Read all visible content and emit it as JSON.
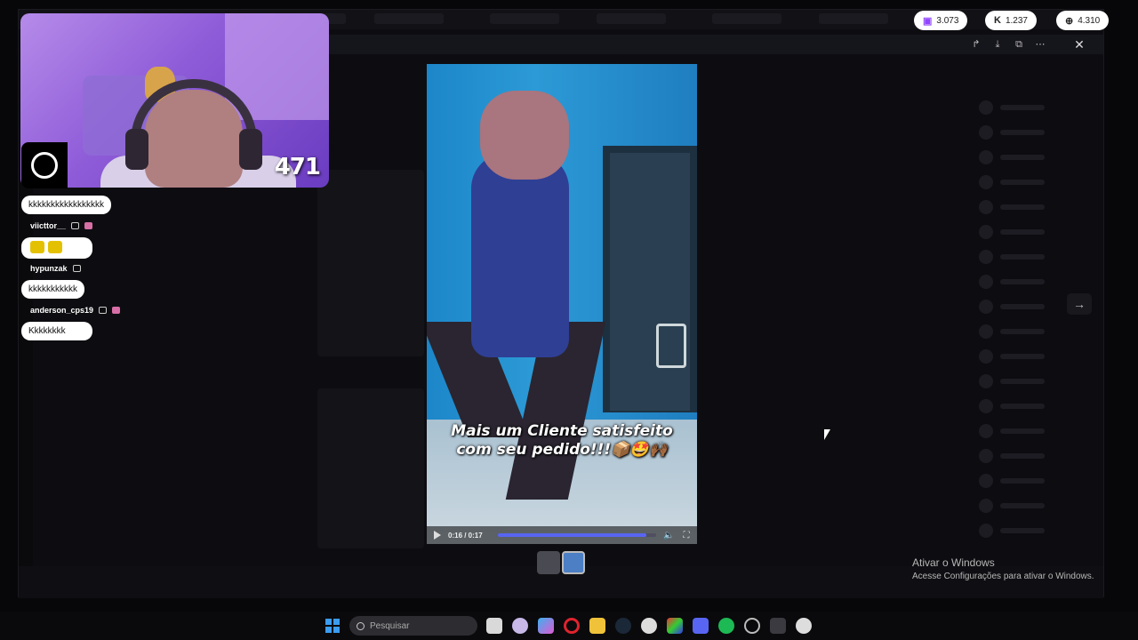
{
  "stats": {
    "twitch_count": "3.073",
    "kick_count": "1.237",
    "total_count": "4.310",
    "twitch_icon": "twitch-icon",
    "kick_icon": "kick-icon",
    "globe_icon": "globe-icon"
  },
  "webcam": {
    "counter": "471"
  },
  "chat": {
    "messages": [
      {
        "user": "",
        "text": "kkkkkkkkkkkkkkkkk"
      },
      {
        "user": "viicttor__",
        "text": ""
      },
      {
        "user": "hypunzak",
        "text": "kkkkkkkkkkk"
      },
      {
        "user": "anderson_cps19",
        "text": "Kkkkkkkk"
      }
    ]
  },
  "video": {
    "caption_line1": "Mais um Cliente satisfeito",
    "caption_line2": "com seu pedido!!!📦🤩🙌🏾",
    "time": "0:16 / 0:17",
    "progress": 0.94
  },
  "windows": {
    "activate_title": "Ativar o Windows",
    "activate_sub": "Acesse Configurações para ativar o Windows."
  },
  "taskbar": {
    "search_placeholder": "Pesquisar"
  },
  "colors": {
    "accent": "#5865f2",
    "twitch": "#9146ff"
  }
}
